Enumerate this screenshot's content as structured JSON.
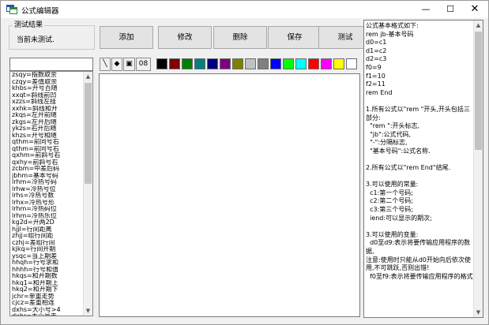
{
  "window": {
    "title": "公式编辑器",
    "minimize": "—",
    "maximize": "☐",
    "close": "✕"
  },
  "test_result": {
    "legend": "测试结果",
    "status": "当前未测试."
  },
  "toolbar": {
    "add": "添加",
    "edit": "修改",
    "delete": "删除",
    "save": "保存",
    "test": "测试"
  },
  "filter": {
    "value": ""
  },
  "formula_list": [
    "zsqy=指数取余",
    "czqy=差值取余",
    "khbs=开号百随",
    "xxqt=斜线前凹",
    "xzzs=斜线左挂",
    "xxhk=斜线和开",
    "zkqs=左开前随",
    "zkgs=左开后随",
    "ykzs=右开后随",
    "khzs=开号和随",
    "qthm=前同号右",
    "qthm=前同号右",
    "qxhm=前斜号右",
    "qxhy=前斜号右",
    "zcbm=中差后码",
    "jbhm=基本号码",
    "lrhm=冷热号码",
    "lrhw=冷热号位",
    "lrhs=冷热号数",
    "lrhx=冷热号形",
    "lrhm=冷热码位",
    "lrhm=冷热乐位",
    "kg2d=开两2D",
    "hjjl=行间距离",
    "zhjj=组行间距",
    "czhj=差组行间",
    "kjkq=行间开期",
    "ysqc=当上期差",
    "hhqh=行号求和",
    "hhhh=行号和值",
    "hkqs=和开期数",
    "hkq1=和开期上",
    "hkq2=和开期下",
    "jchr=单重走势",
    "cjcz=差重相连",
    "dxhs=大小号>4",
    "dxhr=大小号走"
  ],
  "tools": {
    "pen": "╲",
    "diamond": "◆",
    "clipboard": "▣",
    "number": "08"
  },
  "palette": [
    "#000000",
    "#7f0000",
    "#007f00",
    "#008080",
    "#00007f",
    "#7f007f",
    "#7f7f00",
    "#c0c0c0",
    "#7f7f7f",
    "#0000ff",
    "#00ff00",
    "#00ffff",
    "#ff0000",
    "#ff00ff",
    "#ffff00",
    "#ffffff"
  ],
  "help": {
    "lines": [
      "公式基本格式如下:",
      "rem jb-基本号码",
      "d0=c1",
      "d1=c2",
      "d2=c3",
      "f0=9",
      "f1=10",
      "f2=11",
      "rem End",
      "",
      "1.所有公式以\"rem \"开头,开头包括三部分:",
      "  \"rem \":开头标志,",
      "  \"jb\":公式代码,",
      "  \"-\":分隔标志,",
      "  \"基本号码\":公式名称.",
      "",
      "2.所有公式以\"rem End\"结尾.",
      "",
      "3.可以使用的常量:",
      "  c1:第一个号码;",
      "  c2:第二个号码;",
      "  c3:第三个号码;",
      "  iend:可以显示的期次;",
      "",
      "3.可以使用的变量:",
      "  d0至d9:表示将要传输应用程序的数据,",
      "注意:使用时只能从d0开始向后依次使用,不可跳跃,否则出错!",
      "  f0至f9:表示将要传输应用程序的格式"
    ]
  }
}
